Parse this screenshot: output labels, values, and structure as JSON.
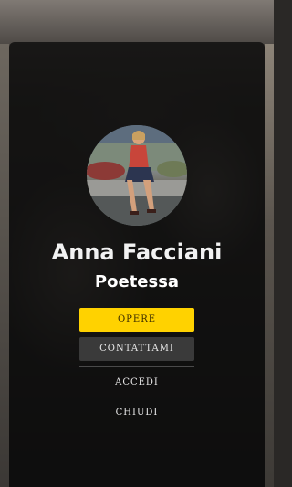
{
  "profile": {
    "name": "Anna Facciani",
    "role": "Poetessa"
  },
  "menu": {
    "primary_label": "OPERE",
    "contact_label": "CONTATTAMI",
    "login_label": "ACCEDI",
    "close_label": "CHIUDI"
  },
  "colors": {
    "accent": "#ffd200",
    "panel": "#0a0a0a",
    "secondary_button": "#3a3a3a"
  }
}
